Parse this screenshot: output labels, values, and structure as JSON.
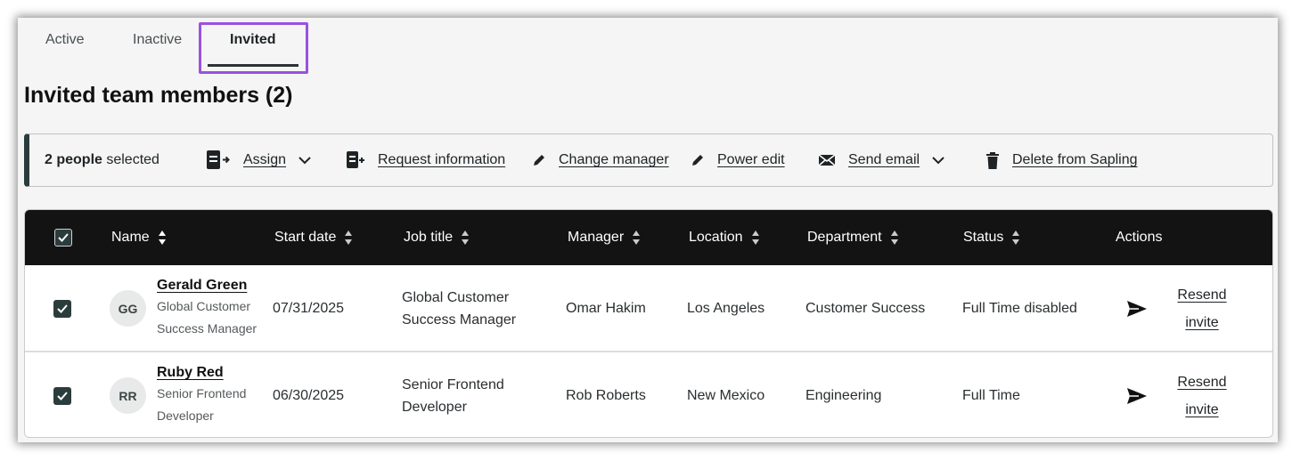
{
  "tabs": [
    {
      "label": "Active"
    },
    {
      "label": "Inactive"
    },
    {
      "label": "Invited"
    }
  ],
  "page_title": "Invited team members (2)",
  "bulk": {
    "count_bold": "2 people",
    "count_rest": " selected",
    "actions": {
      "assign": "Assign",
      "request_information": "Request information",
      "change_manager": "Change manager",
      "power_edit": "Power edit",
      "send_email": "Send email",
      "delete": "Delete from Sapling"
    }
  },
  "table": {
    "headers": {
      "name": "Name",
      "start_date": "Start date",
      "job_title": "Job title",
      "manager": "Manager",
      "location": "Location",
      "department": "Department",
      "status": "Status",
      "actions": "Actions"
    },
    "rows": [
      {
        "initials": "GG",
        "name": "Gerald Green",
        "subtitle": "Global Customer Success Manager",
        "start_date": "07/31/2025",
        "job_title": "Global Customer Success Manager",
        "manager": "Omar Hakim",
        "location": "Los Angeles",
        "department": "Customer Success",
        "status": "Full Time disabled",
        "action_label": "Resend invite"
      },
      {
        "initials": "RR",
        "name": "Ruby Red",
        "subtitle": "Senior Frontend Developer",
        "start_date": "06/30/2025",
        "job_title": "Senior Frontend Developer",
        "manager": "Rob Roberts",
        "location": "New Mexico",
        "department": "Engineering",
        "status": "Full Time",
        "action_label": "Resend invite"
      }
    ]
  },
  "colors": {
    "header_bg": "#131313",
    "tab_highlight": "#9b51e0",
    "checkbox": "#2b3c3c"
  }
}
